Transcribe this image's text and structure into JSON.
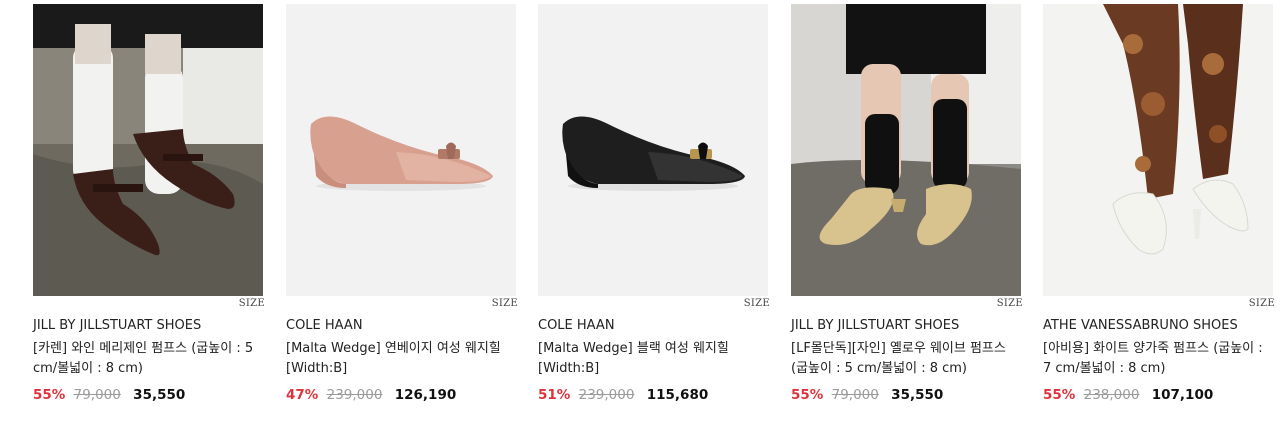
{
  "size_label": "SIZE",
  "products": [
    {
      "brand": "JILL BY JILLSTUART SHOES",
      "name": "[카렌] 와인 메리제인 펌프스 (굽높이 : 5 cm/볼넓이 : 8 cm)",
      "discount": "55%",
      "original_price": "79,000",
      "sale_price": "35,550"
    },
    {
      "brand": "COLE HAAN",
      "name": "[Malta Wedge] 연베이지 여성 웨지힐 [Width:B]",
      "discount": "47%",
      "original_price": "239,000",
      "sale_price": "126,190"
    },
    {
      "brand": "COLE HAAN",
      "name": "[Malta Wedge] 블랙 여성 웨지힐 [Width:B]",
      "discount": "51%",
      "original_price": "239,000",
      "sale_price": "115,680"
    },
    {
      "brand": "JILL BY JILLSTUART SHOES",
      "name": "[LF몰단독][자인] 옐로우 웨이브 펌프스 (굽높이 : 5 cm/볼넓이 : 8 cm)",
      "discount": "55%",
      "original_price": "79,000",
      "sale_price": "35,550"
    },
    {
      "brand": "ATHE VANESSABRUNO SHOES",
      "name": "[아비용] 화이트 양가죽 펌프스 (굽높이 : 7 cm/볼넓이 : 8 cm)",
      "discount": "55%",
      "original_price": "238,000",
      "sale_price": "107,100"
    }
  ]
}
